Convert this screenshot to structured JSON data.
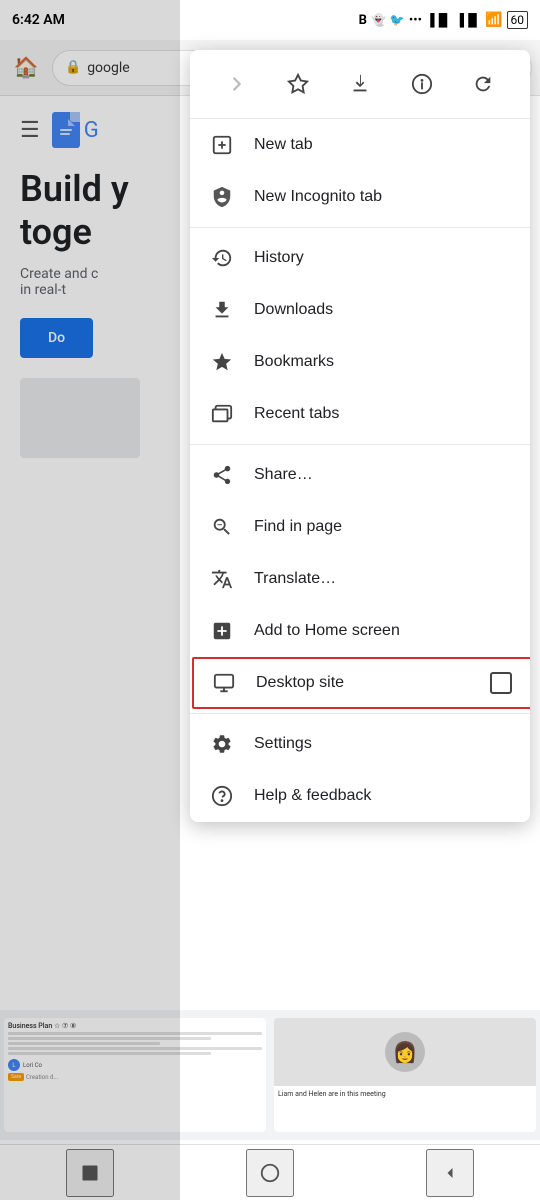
{
  "statusBar": {
    "time": "6:42 AM",
    "icons": [
      "B",
      "👻",
      "🐦",
      "···",
      "📶",
      "📶",
      "📶",
      "🔋60"
    ]
  },
  "browser": {
    "urlText": "google",
    "lockIcon": "🔒"
  },
  "page": {
    "heroTitle": "Build y\ntoge",
    "heroSubtitle": "Create and c\nin real-t",
    "ctaLabel": "Do",
    "docsLogoLetter": "≡"
  },
  "menuTopbar": {
    "forwardIcon": "→",
    "bookmarkIcon": "☆",
    "downloadIcon": "⬇",
    "infoIcon": "ⓘ",
    "refreshIcon": "↻"
  },
  "menuItems": [
    {
      "id": "new-tab",
      "label": "New tab",
      "icon": "new-tab-icon"
    },
    {
      "id": "new-incognito-tab",
      "label": "New Incognito tab",
      "icon": "incognito-icon"
    },
    {
      "id": "history",
      "label": "History",
      "icon": "history-icon"
    },
    {
      "id": "downloads",
      "label": "Downloads",
      "icon": "downloads-icon"
    },
    {
      "id": "bookmarks",
      "label": "Bookmarks",
      "icon": "bookmarks-icon"
    },
    {
      "id": "recent-tabs",
      "label": "Recent tabs",
      "icon": "recent-tabs-icon"
    },
    {
      "id": "share",
      "label": "Share…",
      "icon": "share-icon"
    },
    {
      "id": "find-in-page",
      "label": "Find in page",
      "icon": "find-icon"
    },
    {
      "id": "translate",
      "label": "Translate…",
      "icon": "translate-icon"
    },
    {
      "id": "add-to-home",
      "label": "Add to Home screen",
      "icon": "add-home-icon"
    },
    {
      "id": "desktop-site",
      "label": "Desktop site",
      "icon": "desktop-icon",
      "highlighted": true
    },
    {
      "id": "settings",
      "label": "Settings",
      "icon": "settings-icon"
    },
    {
      "id": "help-feedback",
      "label": "Help & feedback",
      "icon": "help-icon"
    }
  ],
  "navBar": {
    "backIcon": "◀",
    "homeIcon": "⬤",
    "squareIcon": "■"
  }
}
